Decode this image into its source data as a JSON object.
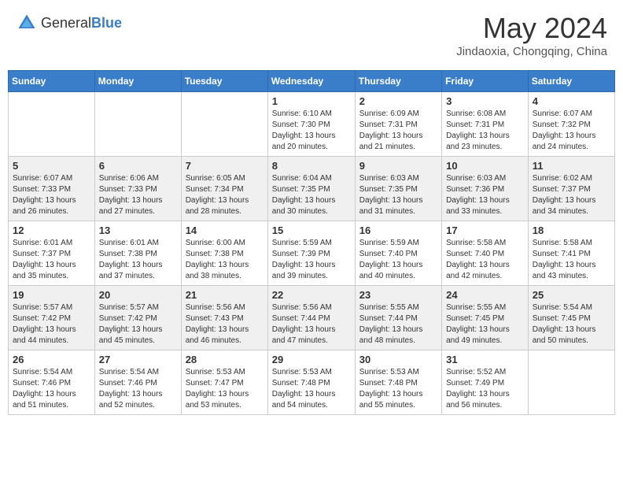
{
  "header": {
    "logo_general": "General",
    "logo_blue": "Blue",
    "title": "May 2024",
    "location": "Jindaoxia, Chongqing, China"
  },
  "weekdays": [
    "Sunday",
    "Monday",
    "Tuesday",
    "Wednesday",
    "Thursday",
    "Friday",
    "Saturday"
  ],
  "weeks": [
    [
      {
        "day": "",
        "sunrise": "",
        "sunset": "",
        "daylight": ""
      },
      {
        "day": "",
        "sunrise": "",
        "sunset": "",
        "daylight": ""
      },
      {
        "day": "",
        "sunrise": "",
        "sunset": "",
        "daylight": ""
      },
      {
        "day": "1",
        "sunrise": "Sunrise: 6:10 AM",
        "sunset": "Sunset: 7:30 PM",
        "daylight": "Daylight: 13 hours and 20 minutes."
      },
      {
        "day": "2",
        "sunrise": "Sunrise: 6:09 AM",
        "sunset": "Sunset: 7:31 PM",
        "daylight": "Daylight: 13 hours and 21 minutes."
      },
      {
        "day": "3",
        "sunrise": "Sunrise: 6:08 AM",
        "sunset": "Sunset: 7:31 PM",
        "daylight": "Daylight: 13 hours and 23 minutes."
      },
      {
        "day": "4",
        "sunrise": "Sunrise: 6:07 AM",
        "sunset": "Sunset: 7:32 PM",
        "daylight": "Daylight: 13 hours and 24 minutes."
      }
    ],
    [
      {
        "day": "5",
        "sunrise": "Sunrise: 6:07 AM",
        "sunset": "Sunset: 7:33 PM",
        "daylight": "Daylight: 13 hours and 26 minutes."
      },
      {
        "day": "6",
        "sunrise": "Sunrise: 6:06 AM",
        "sunset": "Sunset: 7:33 PM",
        "daylight": "Daylight: 13 hours and 27 minutes."
      },
      {
        "day": "7",
        "sunrise": "Sunrise: 6:05 AM",
        "sunset": "Sunset: 7:34 PM",
        "daylight": "Daylight: 13 hours and 28 minutes."
      },
      {
        "day": "8",
        "sunrise": "Sunrise: 6:04 AM",
        "sunset": "Sunset: 7:35 PM",
        "daylight": "Daylight: 13 hours and 30 minutes."
      },
      {
        "day": "9",
        "sunrise": "Sunrise: 6:03 AM",
        "sunset": "Sunset: 7:35 PM",
        "daylight": "Daylight: 13 hours and 31 minutes."
      },
      {
        "day": "10",
        "sunrise": "Sunrise: 6:03 AM",
        "sunset": "Sunset: 7:36 PM",
        "daylight": "Daylight: 13 hours and 33 minutes."
      },
      {
        "day": "11",
        "sunrise": "Sunrise: 6:02 AM",
        "sunset": "Sunset: 7:37 PM",
        "daylight": "Daylight: 13 hours and 34 minutes."
      }
    ],
    [
      {
        "day": "12",
        "sunrise": "Sunrise: 6:01 AM",
        "sunset": "Sunset: 7:37 PM",
        "daylight": "Daylight: 13 hours and 35 minutes."
      },
      {
        "day": "13",
        "sunrise": "Sunrise: 6:01 AM",
        "sunset": "Sunset: 7:38 PM",
        "daylight": "Daylight: 13 hours and 37 minutes."
      },
      {
        "day": "14",
        "sunrise": "Sunrise: 6:00 AM",
        "sunset": "Sunset: 7:38 PM",
        "daylight": "Daylight: 13 hours and 38 minutes."
      },
      {
        "day": "15",
        "sunrise": "Sunrise: 5:59 AM",
        "sunset": "Sunset: 7:39 PM",
        "daylight": "Daylight: 13 hours and 39 minutes."
      },
      {
        "day": "16",
        "sunrise": "Sunrise: 5:59 AM",
        "sunset": "Sunset: 7:40 PM",
        "daylight": "Daylight: 13 hours and 40 minutes."
      },
      {
        "day": "17",
        "sunrise": "Sunrise: 5:58 AM",
        "sunset": "Sunset: 7:40 PM",
        "daylight": "Daylight: 13 hours and 42 minutes."
      },
      {
        "day": "18",
        "sunrise": "Sunrise: 5:58 AM",
        "sunset": "Sunset: 7:41 PM",
        "daylight": "Daylight: 13 hours and 43 minutes."
      }
    ],
    [
      {
        "day": "19",
        "sunrise": "Sunrise: 5:57 AM",
        "sunset": "Sunset: 7:42 PM",
        "daylight": "Daylight: 13 hours and 44 minutes."
      },
      {
        "day": "20",
        "sunrise": "Sunrise: 5:57 AM",
        "sunset": "Sunset: 7:42 PM",
        "daylight": "Daylight: 13 hours and 45 minutes."
      },
      {
        "day": "21",
        "sunrise": "Sunrise: 5:56 AM",
        "sunset": "Sunset: 7:43 PM",
        "daylight": "Daylight: 13 hours and 46 minutes."
      },
      {
        "day": "22",
        "sunrise": "Sunrise: 5:56 AM",
        "sunset": "Sunset: 7:44 PM",
        "daylight": "Daylight: 13 hours and 47 minutes."
      },
      {
        "day": "23",
        "sunrise": "Sunrise: 5:55 AM",
        "sunset": "Sunset: 7:44 PM",
        "daylight": "Daylight: 13 hours and 48 minutes."
      },
      {
        "day": "24",
        "sunrise": "Sunrise: 5:55 AM",
        "sunset": "Sunset: 7:45 PM",
        "daylight": "Daylight: 13 hours and 49 minutes."
      },
      {
        "day": "25",
        "sunrise": "Sunrise: 5:54 AM",
        "sunset": "Sunset: 7:45 PM",
        "daylight": "Daylight: 13 hours and 50 minutes."
      }
    ],
    [
      {
        "day": "26",
        "sunrise": "Sunrise: 5:54 AM",
        "sunset": "Sunset: 7:46 PM",
        "daylight": "Daylight: 13 hours and 51 minutes."
      },
      {
        "day": "27",
        "sunrise": "Sunrise: 5:54 AM",
        "sunset": "Sunset: 7:46 PM",
        "daylight": "Daylight: 13 hours and 52 minutes."
      },
      {
        "day": "28",
        "sunrise": "Sunrise: 5:53 AM",
        "sunset": "Sunset: 7:47 PM",
        "daylight": "Daylight: 13 hours and 53 minutes."
      },
      {
        "day": "29",
        "sunrise": "Sunrise: 5:53 AM",
        "sunset": "Sunset: 7:48 PM",
        "daylight": "Daylight: 13 hours and 54 minutes."
      },
      {
        "day": "30",
        "sunrise": "Sunrise: 5:53 AM",
        "sunset": "Sunset: 7:48 PM",
        "daylight": "Daylight: 13 hours and 55 minutes."
      },
      {
        "day": "31",
        "sunrise": "Sunrise: 5:52 AM",
        "sunset": "Sunset: 7:49 PM",
        "daylight": "Daylight: 13 hours and 56 minutes."
      },
      {
        "day": "",
        "sunrise": "",
        "sunset": "",
        "daylight": ""
      }
    ]
  ]
}
